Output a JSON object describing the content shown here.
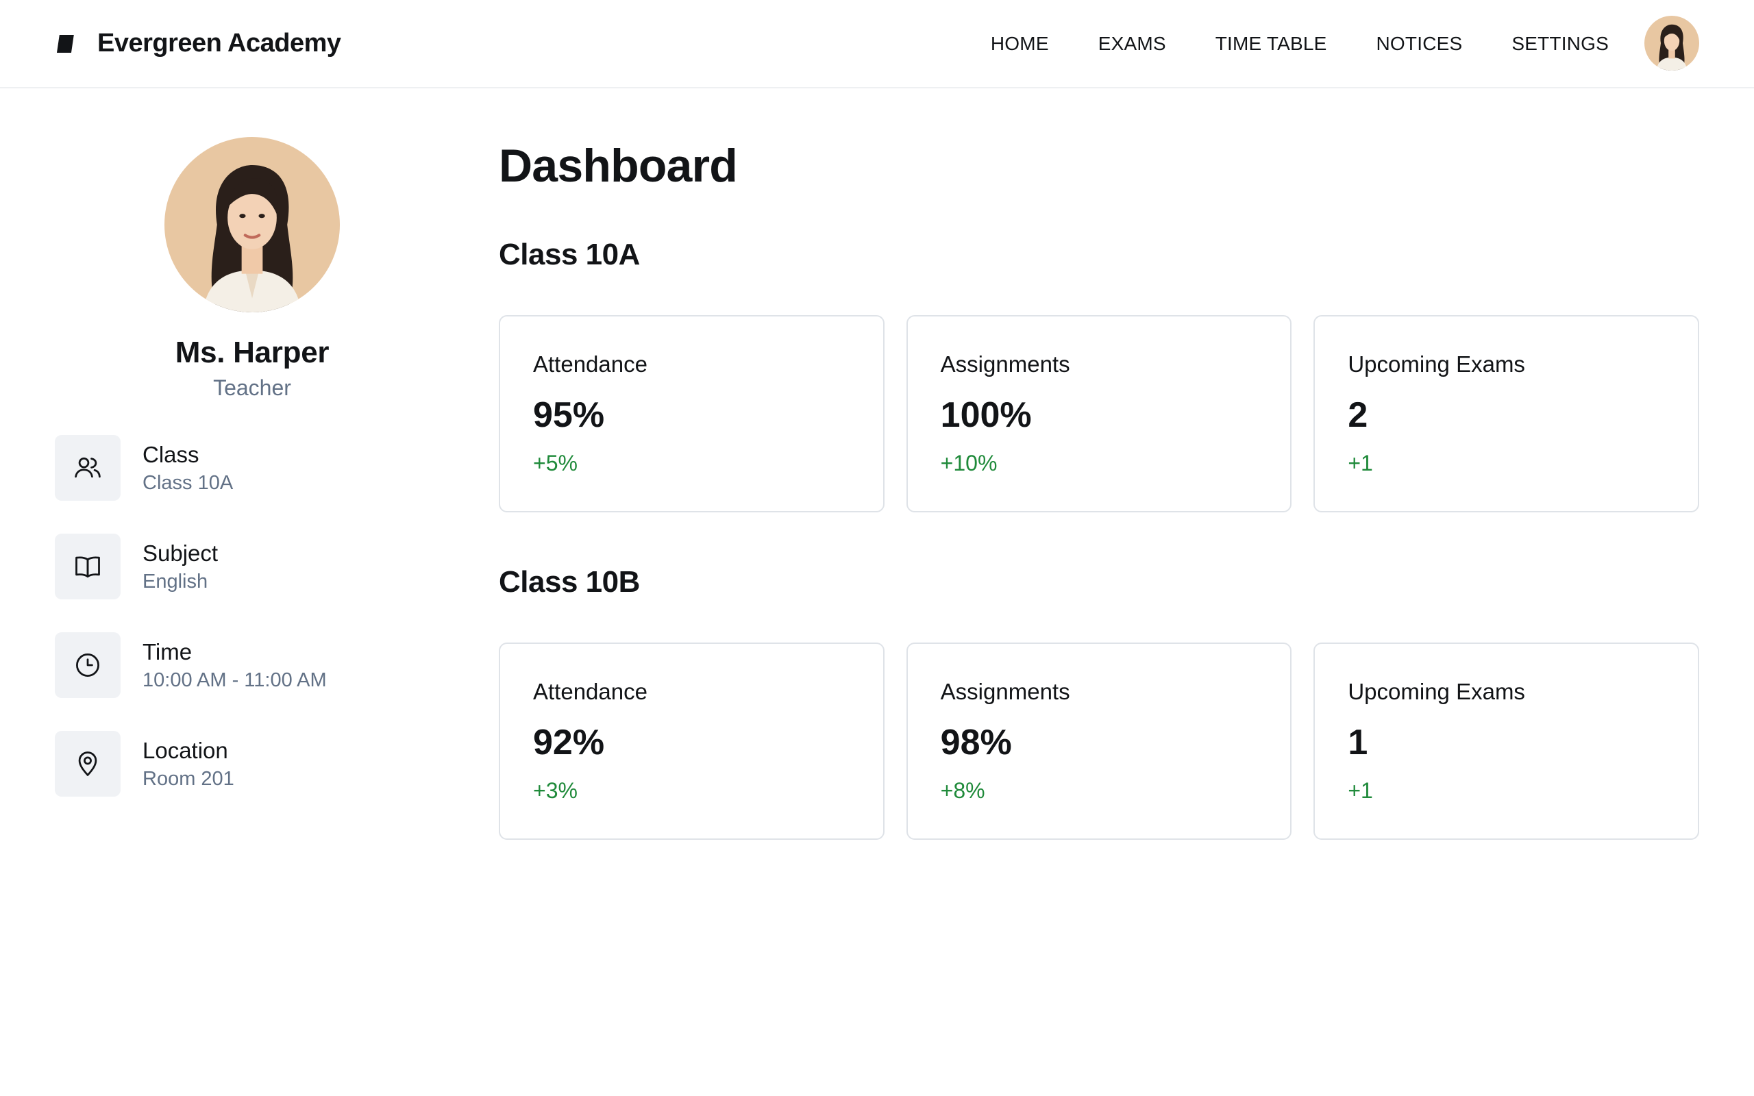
{
  "brand": {
    "name": "Evergreen Academy"
  },
  "nav": {
    "items": [
      "HOME",
      "EXAMS",
      "TIME TABLE",
      "NOTICES",
      "SETTINGS"
    ]
  },
  "profile": {
    "name": "Ms. Harper",
    "role": "Teacher",
    "details": [
      {
        "icon": "users-icon",
        "label": "Class",
        "value": "Class 10A"
      },
      {
        "icon": "book-icon",
        "label": "Subject",
        "value": "English"
      },
      {
        "icon": "clock-icon",
        "label": "Time",
        "value": "10:00 AM - 11:00 AM"
      },
      {
        "icon": "location-pin-icon",
        "label": "Location",
        "value": "Room 201"
      }
    ]
  },
  "main": {
    "title": "Dashboard",
    "classes": [
      {
        "name": "Class 10A",
        "stats": [
          {
            "label": "Attendance",
            "value": "95%",
            "delta": "+5%"
          },
          {
            "label": "Assignments",
            "value": "100%",
            "delta": "+10%"
          },
          {
            "label": "Upcoming Exams",
            "value": "2",
            "delta": "+1"
          }
        ]
      },
      {
        "name": "Class 10B",
        "stats": [
          {
            "label": "Attendance",
            "value": "92%",
            "delta": "+3%"
          },
          {
            "label": "Assignments",
            "value": "98%",
            "delta": "+8%"
          },
          {
            "label": "Upcoming Exams",
            "value": "1",
            "delta": "+1"
          }
        ]
      }
    ]
  },
  "colors": {
    "text": "#121417",
    "muted": "#627186",
    "positive": "#1f8a3a",
    "icon_bg": "#f0f2f5",
    "card_border": "#dfe3e8",
    "avatar_bg": "#e8c7a2"
  }
}
